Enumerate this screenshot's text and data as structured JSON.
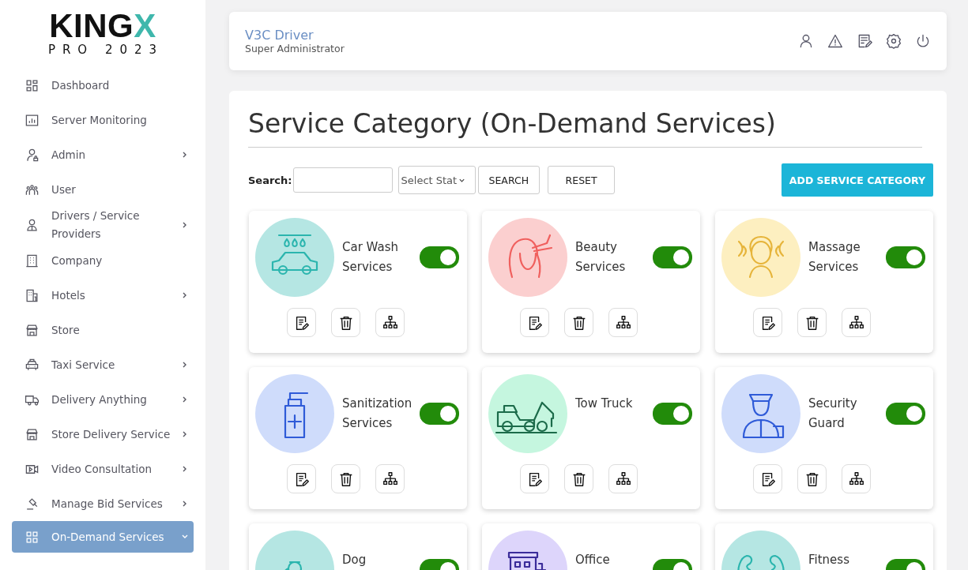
{
  "logo": {
    "word": "KING",
    "accent": "X",
    "subtitle": "PRO 2023"
  },
  "sidebar": {
    "items": [
      {
        "label": "Dashboard",
        "has_submenu": false,
        "selected": false
      },
      {
        "label": "Server Monitoring",
        "has_submenu": false,
        "selected": false
      },
      {
        "label": "Admin",
        "has_submenu": true,
        "selected": false
      },
      {
        "label": "User",
        "has_submenu": false,
        "selected": false
      },
      {
        "label": "Drivers / Service Providers",
        "has_submenu": true,
        "selected": false
      },
      {
        "label": "Company",
        "has_submenu": false,
        "selected": false
      },
      {
        "label": "Hotels",
        "has_submenu": true,
        "selected": false
      },
      {
        "label": "Store",
        "has_submenu": false,
        "selected": false
      },
      {
        "label": "Taxi Service",
        "has_submenu": true,
        "selected": false
      },
      {
        "label": "Delivery Anything",
        "has_submenu": true,
        "selected": false
      },
      {
        "label": "Store Delivery Service",
        "has_submenu": true,
        "selected": false
      },
      {
        "label": "Video Consultation",
        "has_submenu": true,
        "selected": false
      },
      {
        "label": "Manage Bid Services",
        "has_submenu": true,
        "selected": false
      },
      {
        "label": "On-Demand Services",
        "has_submenu": true,
        "selected": true
      }
    ]
  },
  "header": {
    "user_name": "V3C Driver",
    "role": "Super Administrator"
  },
  "page": {
    "title": "Service Category (On-Demand Services)",
    "search": {
      "label": "Search:",
      "status_placeholder": "Select Stat",
      "search_button": "SEARCH",
      "reset_button": "RESET"
    },
    "add_button": "ADD SERVICE CATEGORY",
    "cards": [
      {
        "name": "Car Wash Services",
        "color": "#b5e6e3",
        "enabled": true
      },
      {
        "name": "Beauty Services",
        "color": "#fbcfcf",
        "enabled": true
      },
      {
        "name": "Massage Services",
        "color": "#fdefc0",
        "enabled": true
      },
      {
        "name": "Sanitization Services",
        "color": "#cfdcfb",
        "enabled": true
      },
      {
        "name": "Tow Truck",
        "color": "#c5f6df",
        "enabled": true
      },
      {
        "name": "Security Guard",
        "color": "#cfdcfb",
        "enabled": true
      },
      {
        "name": "Dog",
        "color": "#b5e6e3",
        "enabled": true
      },
      {
        "name": "Office",
        "color": "#ddd5fb",
        "enabled": true
      },
      {
        "name": "Fitness",
        "color": "#b5e6e3",
        "enabled": true
      }
    ]
  }
}
